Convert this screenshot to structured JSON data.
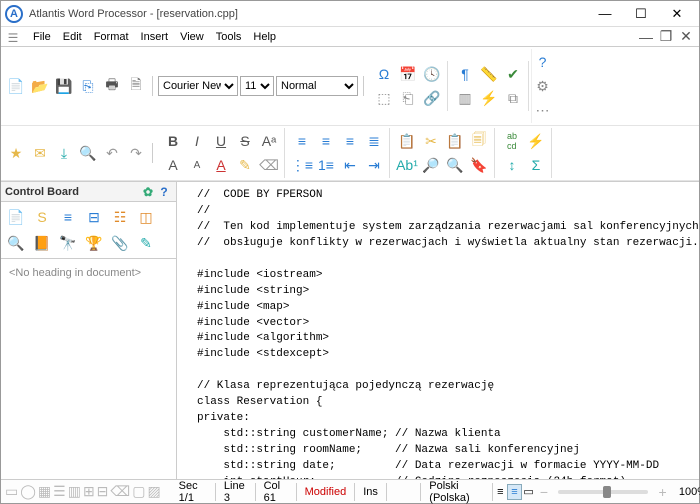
{
  "window": {
    "app_name": "Atlantis Word Processor",
    "doc_name": "[reservation.cpp]",
    "title": "Atlantis Word Processor - [reservation.cpp]"
  },
  "menu": [
    "File",
    "Edit",
    "Format",
    "Insert",
    "View",
    "Tools",
    "Help"
  ],
  "font": {
    "name": "Courier New",
    "size": "11",
    "style": "Normal"
  },
  "control_board": {
    "title": "Control Board",
    "msg": "<No heading in document>"
  },
  "status": {
    "sec": "Sec 1/1",
    "line": "Line 3",
    "col": "Col 61",
    "mod": "Modified",
    "ins": "Ins",
    "lang": "Polski (Polska)",
    "zoom": "100%"
  },
  "code": "//  CODE BY FPERSON\n//\n//  Ten kod implementuje system zarządzania rezerwacjami sal konferencyjnych,\n//  obsługuje konflikty w rezerwacjach i wyświetla aktualny stan rezerwacji.\n\n#include <iostream>\n#include <string>\n#include <map>\n#include <vector>\n#include <algorithm>\n#include <stdexcept>\n\n// Klasa reprezentująca pojedynczą rezerwację\nclass Reservation {\nprivate:\n    std::string customerName; // Nazwa klienta\n    std::string roomName;     // Nazwa sali konferencyjnej\n    std::string date;         // Data rezerwacji w formacie YYYY-MM-DD\n    int startHour;            // Godzina rozpoczęcia (24h format)\n    int endHour;              // Godzina zakończenia (24h format)\n\npublic:\n    // Konstruktor\n    Reservation(const std::string& customer, const std::string& room, const std::string& date, int start, int end)\n        : customerName(customer), roomName(room), date(date), startHour(start), endHour(end) {\n        if (start >= end || start < 0 || end > 24) {\n            throw std::invalid_argument(\"Nieprawidłowy zakres godzin!\");\n        }\n    }"
}
